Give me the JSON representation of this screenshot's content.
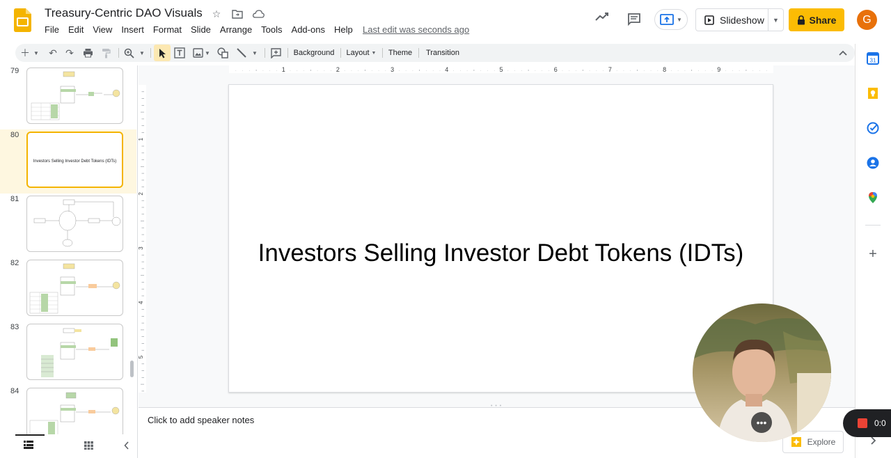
{
  "app": {
    "doc_title": "Treasury-Centric DAO Visuals",
    "last_edit": "Last edit was seconds ago",
    "user_initial": "G"
  },
  "menu": [
    "File",
    "Edit",
    "View",
    "Insert",
    "Format",
    "Slide",
    "Arrange",
    "Tools",
    "Add-ons",
    "Help"
  ],
  "header": {
    "slideshow_label": "Slideshow",
    "share_label": "Share"
  },
  "toolbar": {
    "background_label": "Background",
    "layout_label": "Layout",
    "theme_label": "Theme",
    "transition_label": "Transition"
  },
  "ruler": {
    "top_marks": [
      "1",
      "2",
      "3",
      "4",
      "5",
      "6",
      "7",
      "8",
      "9"
    ],
    "left_marks": [
      "1",
      "2",
      "3",
      "4",
      "5"
    ]
  },
  "filmstrip": {
    "slides": [
      {
        "number": "79",
        "text": ""
      },
      {
        "number": "80",
        "text": "Investors Selling Investor Debt Tokens (IDTs)",
        "selected": true
      },
      {
        "number": "81",
        "text": ""
      },
      {
        "number": "82",
        "text": ""
      },
      {
        "number": "83",
        "text": ""
      },
      {
        "number": "84",
        "text": ""
      }
    ]
  },
  "slide": {
    "title": "Investors Selling Investor Debt Tokens (IDTs)"
  },
  "notes": {
    "placeholder": "Click to add speaker notes"
  },
  "explore_label": "Explore",
  "recording": {
    "timer": "0:0"
  },
  "colors": {
    "accent": "#fbbc04",
    "selection": "#f4b400",
    "record": "#ea4335"
  }
}
